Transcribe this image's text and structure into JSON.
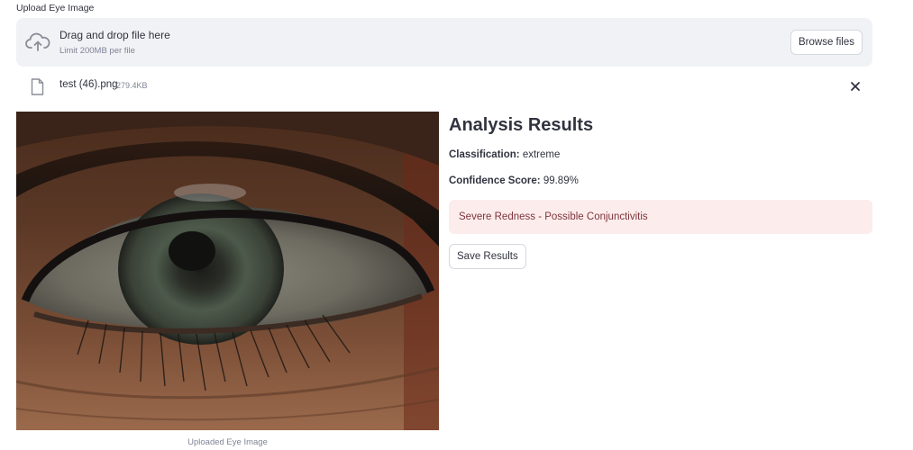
{
  "uploader": {
    "label": "Upload Eye Image",
    "dropzone_title": "Drag and drop file here",
    "dropzone_limit": "Limit 200MB per file",
    "browse_label": "Browse files",
    "cloud_icon": "cloud-upload-icon"
  },
  "file": {
    "name": "test (46).png",
    "size": "279.4KB",
    "file_icon": "file-icon",
    "remove_icon": "close-icon"
  },
  "image": {
    "caption": "Uploaded Eye Image"
  },
  "results": {
    "title": "Analysis Results",
    "classification_label": "Classification:",
    "classification_value": "extreme",
    "confidence_label": "Confidence Score:",
    "confidence_value": "99.89%",
    "alert": "Severe Redness - Possible Conjunctivitis",
    "save_label": "Save Results"
  },
  "colors": {
    "dropzone_bg": "#f0f2f6",
    "alert_bg": "#fdecec",
    "alert_text": "#7d353b",
    "muted_text": "#808495"
  }
}
